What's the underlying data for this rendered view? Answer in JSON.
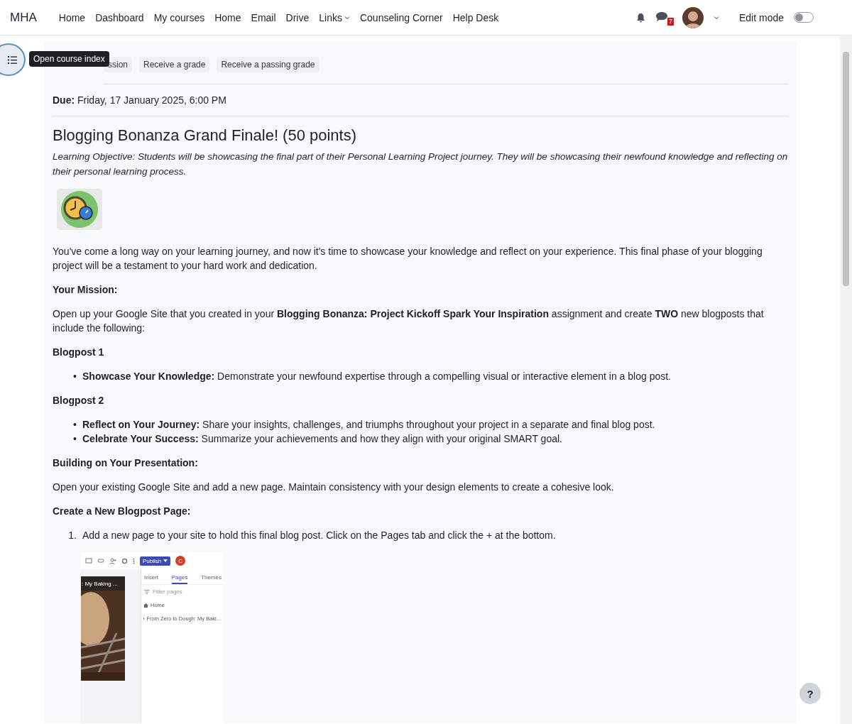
{
  "navbar": {
    "brand": "MHA",
    "links": [
      {
        "label": "Home",
        "dropdown": false
      },
      {
        "label": "Dashboard",
        "dropdown": false
      },
      {
        "label": "My courses",
        "dropdown": false
      },
      {
        "label": "Home",
        "dropdown": false
      },
      {
        "label": "Email",
        "dropdown": false
      },
      {
        "label": "Drive",
        "dropdown": false
      },
      {
        "label": "Links",
        "dropdown": true
      },
      {
        "label": "Counseling Corner",
        "dropdown": false
      },
      {
        "label": "Help Desk",
        "dropdown": false
      }
    ],
    "message_count": "7",
    "edit_mode": {
      "label": "Edit mode",
      "on": false
    }
  },
  "course_index": {
    "tooltip": "Open course index"
  },
  "completion_chips": [
    "ssion",
    "Receive a grade",
    "Receive a passing grade"
  ],
  "due": {
    "label": "Due:",
    "value": "Friday, 17 January 2025, 6:00 PM"
  },
  "title": "Blogging Bonanza Grand Finale! (50 points)",
  "objective": "Learning Objective: Students will be showcasing the final part of their Personal Learning Project journey. They will be showcasing their newfound knowledge and reflecting on their personal learning process.",
  "blocks": [
    {
      "kind": "paragraph",
      "text": "You've come a long way on your learning journey, and now it's time to showcase your knowledge and reflect on your experience. This final phase of your blogging project will be a testament to your hard work and dedication."
    },
    {
      "kind": "heading",
      "text": "Your Mission:"
    },
    {
      "kind": "paragraph",
      "text": "Open up your Google Site that you created in your **Blogging Bonanza:  Project Kickoff Spark Your Inspiration** assignment and create **TWO** new blogposts that include the following:"
    },
    {
      "kind": "heading",
      "text": "Blogpost 1"
    },
    {
      "kind": "bullets",
      "items": [
        {
          "marker": "•",
          "text": "**Showcase Your Knowledge:** Demonstrate your newfound expertise through a compelling visual or interactive element in a blog post."
        }
      ]
    },
    {
      "kind": "heading",
      "text": "Blogpost 2"
    },
    {
      "kind": "bullets",
      "items": [
        {
          "marker": "•",
          "text": "**Reflect on Your Journey:** Share your insights, challenges, and triumphs throughout your project in a separate and final blog post."
        },
        {
          "marker": "•",
          "text": "**Celebrate Your Success:** Summarize your achievements and how they align with your original SMART goal."
        }
      ]
    },
    {
      "kind": "heading",
      "text": "Building on Your Presentation:"
    },
    {
      "kind": "paragraph",
      "text": "Open your existing Google Site and add a new page. Maintain consistency with your design elements to create a cohesive look."
    },
    {
      "kind": "heading",
      "text": "Create a New Blogpost Page:"
    },
    {
      "kind": "ordered",
      "items": [
        {
          "marker": "1.",
          "text": "Add a new page to your site to hold this final blog post. Click on the Pages tab and click the + at the bottom."
        }
      ]
    }
  ],
  "embedded_screenshot": {
    "publish": "Publish",
    "account_initial": "C",
    "banner_text": ": My Baking ...",
    "tabs": [
      {
        "label": "Insert",
        "selected": false
      },
      {
        "label": "Pages",
        "selected": true
      },
      {
        "label": "Themes",
        "selected": false
      }
    ],
    "filter_placeholder": "Filter pages",
    "pages": [
      {
        "kind": "home",
        "label": "Home"
      },
      {
        "kind": "page",
        "label": "From Zero to Dough: My Baki..."
      }
    ]
  },
  "help": "?"
}
